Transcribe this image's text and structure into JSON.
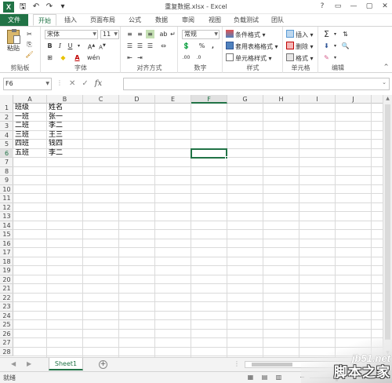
{
  "window": {
    "title": "重复数据.xlsx - Excel",
    "controls": [
      "?",
      "▭",
      "—",
      "▢",
      "✕"
    ]
  },
  "quick_access": {
    "icons": [
      "excel-logo",
      "save-icon",
      "undo-icon",
      "redo-icon",
      "customize-icon"
    ]
  },
  "tabs": {
    "file": "文件",
    "items": [
      "开始",
      "插入",
      "页面布局",
      "公式",
      "数据",
      "审阅",
      "视图",
      "负载测试",
      "团队"
    ],
    "active": "开始"
  },
  "ribbon": {
    "clipboard": {
      "label": "剪贴板",
      "paste": "粘贴"
    },
    "font": {
      "label": "字体",
      "font_name": "宋体",
      "font_size": "11"
    },
    "alignment": {
      "label": "对齐方式"
    },
    "number": {
      "label": "数字",
      "format": "常规"
    },
    "styles": {
      "label": "样式",
      "conditional": "条件格式 ▾",
      "table": "套用表格格式 ▾",
      "cell_styles": "单元格样式 ▾"
    },
    "cells": {
      "label": "单元格",
      "insert": "插入 ▾",
      "delete": "删除 ▾",
      "format": "格式 ▾"
    },
    "editing": {
      "label": "编辑"
    }
  },
  "formula_bar": {
    "name_box": "F6",
    "fx": "fx",
    "value": ""
  },
  "columns": [
    "A",
    "B",
    "C",
    "D",
    "E",
    "F",
    "G",
    "H",
    "I",
    "J"
  ],
  "selected": {
    "column": "F",
    "row": "6"
  },
  "rows": [
    "1",
    "2",
    "3",
    "4",
    "5",
    "6",
    "7",
    "8",
    "9",
    "10",
    "11",
    "12",
    "13",
    "14",
    "15",
    "16",
    "17",
    "18",
    "19",
    "20",
    "21",
    "22",
    "23",
    "24",
    "25",
    "26",
    "27",
    "28"
  ],
  "cells": [
    {
      "a": "班级",
      "b": "姓名"
    },
    {
      "a": "一班",
      "b": "张一"
    },
    {
      "a": "二班",
      "b": "李二"
    },
    {
      "a": "三班",
      "b": "王三"
    },
    {
      "a": "四班",
      "b": "钱四"
    },
    {
      "a": "五班",
      "b": "李二"
    }
  ],
  "sheets": {
    "active": "Sheet1",
    "add": "+"
  },
  "status": {
    "text": "就绪"
  },
  "watermark": {
    "site": "jb51.net",
    "name": "脚本之家"
  }
}
